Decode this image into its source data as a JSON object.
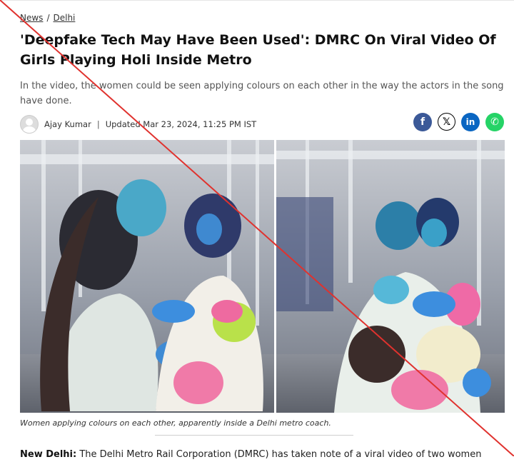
{
  "breadcrumb": {
    "items": [
      "News",
      "Delhi"
    ],
    "separator": "/"
  },
  "article": {
    "title": "'Deepfake Tech May Have Been Used': DMRC On Viral Video Of Girls Playing Holi Inside Metro",
    "subtitle": "In the video, the women could be seen applying colours on each other in the way the actors in the song have done.",
    "author": "Ajay Kumar",
    "divider": "|",
    "updated": "Updated Mar 23, 2024, 11:25 PM IST",
    "caption": "Women applying colours on each other, apparently inside a Delhi metro coach.",
    "dateline": "New Delhi:",
    "first_line": " The Delhi Metro Rail Corporation (DMRC) has taken note of a viral video of two women"
  },
  "share": {
    "facebook": "f",
    "x": "𝕏",
    "linkedin": "in",
    "whatsapp": "✆"
  },
  "icons": {
    "facebook": "facebook-icon",
    "x": "x-icon",
    "linkedin": "linkedin-icon",
    "whatsapp": "whatsapp-icon",
    "avatar": "user-avatar-icon"
  },
  "colors": {
    "strike_line": "#e0322e",
    "facebook": "#3b5998",
    "linkedin": "#0a66c2",
    "whatsapp": "#25d366"
  }
}
